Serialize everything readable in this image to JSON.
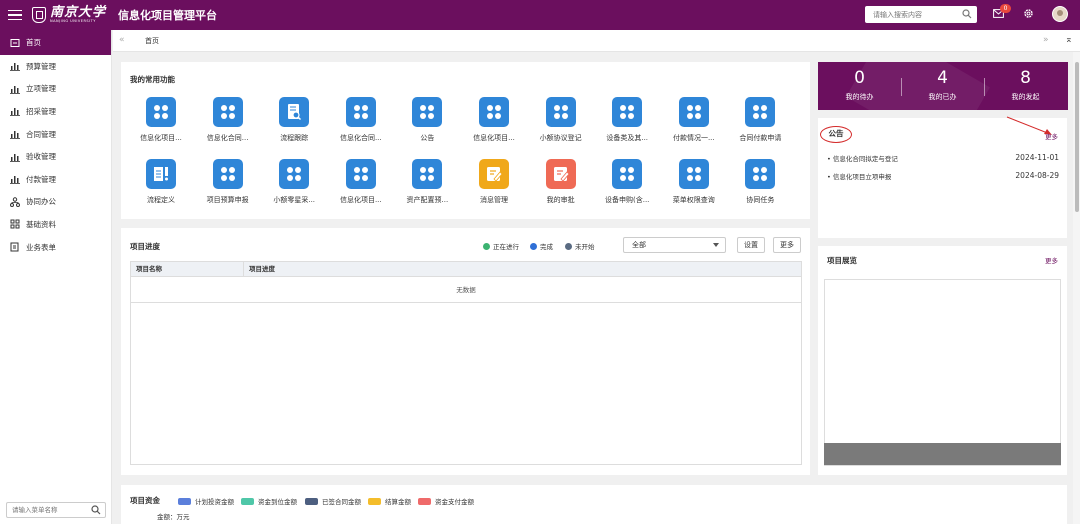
{
  "header": {
    "logo_text": "南京大学",
    "logo_subtext": "NANJING UNIVERSITY",
    "app_title": "信息化项目管理平台",
    "search_placeholder": "请输入搜索内容",
    "mail_badge": "0"
  },
  "sidebar": {
    "items": [
      {
        "label": "首页",
        "icon": "home-icon"
      },
      {
        "label": "预算管理",
        "icon": "bar-chart-icon"
      },
      {
        "label": "立项管理",
        "icon": "bar-chart-icon"
      },
      {
        "label": "招采管理",
        "icon": "bar-chart-icon"
      },
      {
        "label": "合同管理",
        "icon": "bar-chart-icon"
      },
      {
        "label": "验收管理",
        "icon": "bar-chart-icon"
      },
      {
        "label": "付款管理",
        "icon": "bar-chart-icon"
      },
      {
        "label": "协同办公",
        "icon": "org-icon"
      },
      {
        "label": "基础资料",
        "icon": "grid-icon"
      },
      {
        "label": "业务表单",
        "icon": "form-icon"
      }
    ],
    "search_placeholder": "请输入菜单名称"
  },
  "tabs": {
    "home": "首页",
    "prev": "«",
    "next": "»",
    "collapse": "⌅"
  },
  "functions": {
    "title": "我的常用功能",
    "items": [
      {
        "label": "信息化项目...",
        "icon": "dots-icon"
      },
      {
        "label": "信息化合同...",
        "icon": "dots-icon"
      },
      {
        "label": "流程跟踪",
        "icon": "doc-search-icon"
      },
      {
        "label": "信息化合同...",
        "icon": "dots-icon"
      },
      {
        "label": "公告",
        "icon": "dots-icon"
      },
      {
        "label": "信息化项目...",
        "icon": "dots-icon"
      },
      {
        "label": "小额协议登记",
        "icon": "dots-icon"
      },
      {
        "label": "设备类及其...",
        "icon": "dots-icon"
      },
      {
        "label": "付款情况一...",
        "icon": "dots-icon"
      },
      {
        "label": "合同付款申请",
        "icon": "dots-icon"
      },
      {
        "label": "流程定义",
        "icon": "list-icon"
      },
      {
        "label": "项目预算申报",
        "icon": "dots-icon"
      },
      {
        "label": "小额零星采...",
        "icon": "dots-icon"
      },
      {
        "label": "信息化项目...",
        "icon": "dots-icon"
      },
      {
        "label": "资产配置预...",
        "icon": "dots-icon"
      },
      {
        "label": "消息管理",
        "icon": "edit-icon",
        "color": "#f0a81a"
      },
      {
        "label": "我的审批",
        "icon": "edit-icon",
        "color": "#ef6a55"
      },
      {
        "label": "设备申购(含...",
        "icon": "dots-icon"
      },
      {
        "label": "菜单权限查询",
        "icon": "dots-icon"
      },
      {
        "label": "协同任务",
        "icon": "dots-icon"
      }
    ]
  },
  "progress": {
    "title": "项目进度",
    "legend": [
      {
        "label": "正在进行",
        "color": "#3cb371"
      },
      {
        "label": "完成",
        "color": "#2f6fd6"
      },
      {
        "label": "未开始",
        "color": "#5a6b82"
      }
    ],
    "filter_value": "全部",
    "settings_label": "设置",
    "more_label": "更多",
    "columns": [
      "项目名称",
      "项目进度"
    ],
    "empty_text": "无数据"
  },
  "stats": [
    {
      "value": "0",
      "label": "我的待办"
    },
    {
      "value": "4",
      "label": "我的已办"
    },
    {
      "value": "8",
      "label": "我的发起"
    }
  ],
  "announcements": {
    "title": "公告",
    "more_label": "更多",
    "items": [
      {
        "title": "信息化合同拟定与登记",
        "date": "2024-11-01"
      },
      {
        "title": "信息化项目立项申报",
        "date": "2024-08-29"
      }
    ]
  },
  "overview": {
    "title": "项目展览",
    "more_label": "更多"
  },
  "funds": {
    "title": "项目资金",
    "unit_label": "金额：万元",
    "legend": [
      {
        "label": "计划投资金额",
        "color": "#5b7fdb"
      },
      {
        "label": "资金到位金额",
        "color": "#4fc7a8"
      },
      {
        "label": "已签合同金额",
        "color": "#4d5f80"
      },
      {
        "label": "结算金额",
        "color": "#f4bd2b"
      },
      {
        "label": "资金支付金额",
        "color": "#ef6a6a"
      }
    ]
  }
}
